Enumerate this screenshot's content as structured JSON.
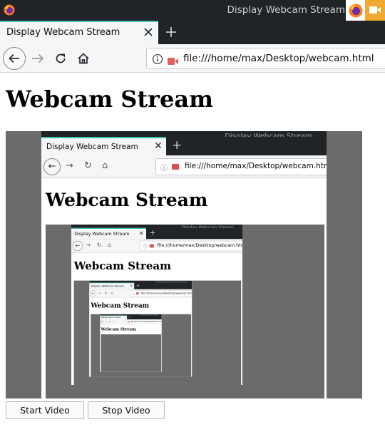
{
  "window": {
    "title": "Display Webcam Stream",
    "tray_icons": [
      "firefox-icon",
      "webcam-active-icon"
    ]
  },
  "tab": {
    "title": "Display Webcam Stream",
    "close_icon": "close-icon",
    "new_tab_icon": "plus-icon"
  },
  "navbar": {
    "url": "file:///home/max/Desktop/webcam.html",
    "icons": [
      "back-arrow-icon",
      "forward-arrow-icon",
      "reload-icon",
      "home-icon",
      "info-icon",
      "camera-permission-icon"
    ]
  },
  "page": {
    "heading": "Webcam Stream",
    "start_button": "Start Video",
    "stop_button": "Stop Video"
  },
  "colors": {
    "titlebar_bg": "#202426",
    "tab_accent": "#3fc1b3",
    "video_bg": "#6b6b6b",
    "webcam_tray": "#f0a830",
    "camera_icon_red": "#d94f4f"
  }
}
